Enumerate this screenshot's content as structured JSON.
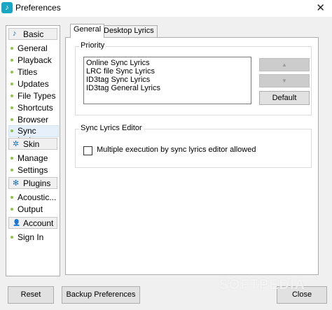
{
  "window": {
    "title": "Preferences",
    "icon": "music-note-icon",
    "close_glyph": "✕"
  },
  "sidebar": {
    "categories": {
      "basic": {
        "label": "Basic",
        "icon": "music-note-icon",
        "glyph": "♪"
      },
      "skin": {
        "label": "Skin",
        "icon": "sparkle-icon",
        "glyph": "✲"
      },
      "plugins": {
        "label": "Plugins",
        "icon": "gear-icon",
        "glyph": "✻"
      },
      "account": {
        "label": "Account",
        "icon": "person-icon",
        "glyph": "👤"
      }
    },
    "items": {
      "general": "General",
      "playback": "Playback",
      "titles": "Titles",
      "updates": "Updates",
      "file_types": "File Types",
      "shortcuts": "Shortcuts",
      "browser": "Browser",
      "sync_lyrics": "Sync Lyrics",
      "manage": "Manage",
      "settings": "Settings",
      "acoustic": "Acoustic...",
      "output": "Output",
      "sign_in": "Sign In"
    },
    "selected": "Sync Lyrics"
  },
  "tabs": {
    "general": "General",
    "desktop_lyrics": "Desktop Lyrics",
    "active": "General"
  },
  "priority": {
    "title": "Priority",
    "items": [
      "Online Sync Lyrics",
      "LRC file Sync Lyrics",
      "ID3tag Sync Lyrics",
      "ID3tag General Lyrics"
    ],
    "up_glyph": "▲",
    "down_glyph": "▼",
    "default_label": "Default"
  },
  "editor": {
    "title": "Sync Lyrics Editor",
    "checkbox_label": "Multiple execution by sync lyrics editor allowed",
    "checked": false
  },
  "footer": {
    "reset_label": "Reset",
    "backup_label": "Backup Preferences",
    "close_label": "Close"
  },
  "watermark": "SOFTPEDIA"
}
